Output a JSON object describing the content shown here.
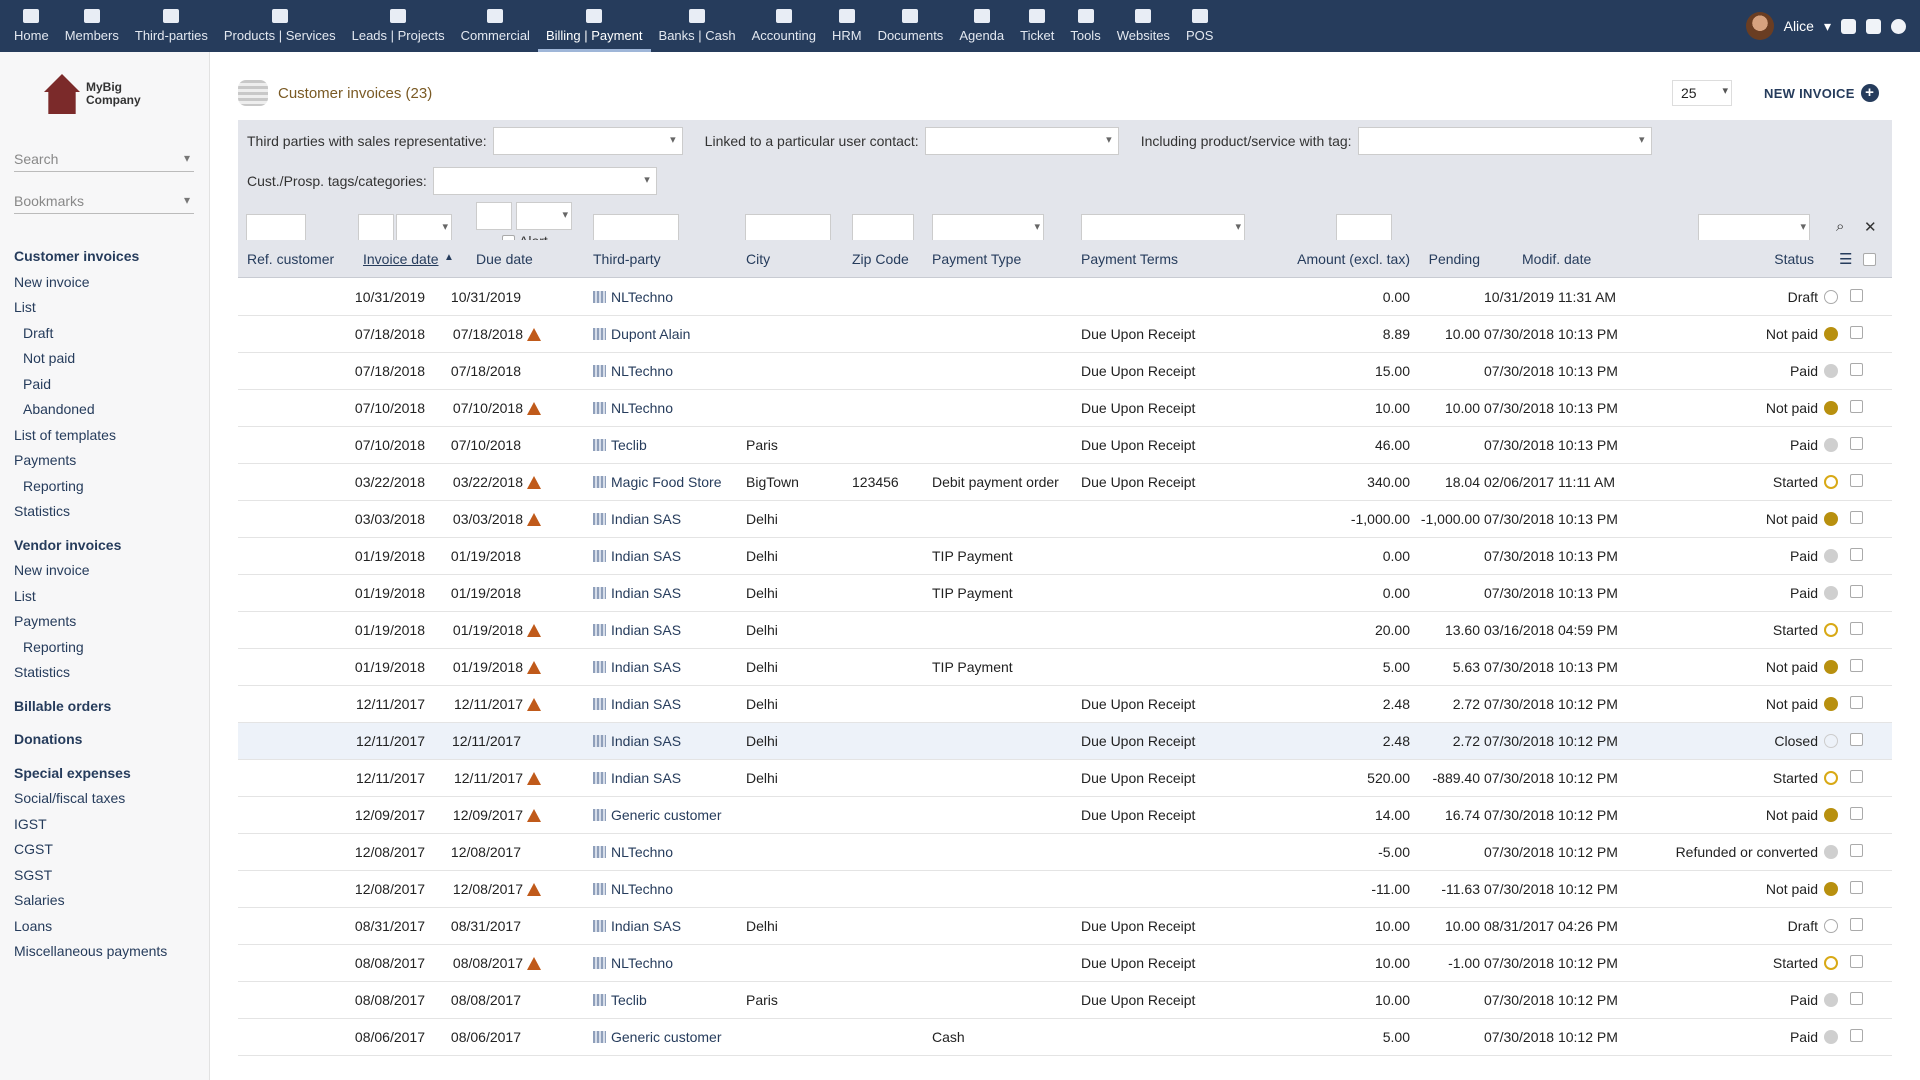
{
  "topmenu": [
    {
      "label": "Home",
      "icon": "home-icon"
    },
    {
      "label": "Members",
      "icon": "members-icon"
    },
    {
      "label": "Third-parties",
      "icon": "building-icon"
    },
    {
      "label": "Products | Services",
      "icon": "cube-icon"
    },
    {
      "label": "Leads | Projects",
      "icon": "sitemap-icon"
    },
    {
      "label": "Commercial",
      "icon": "suitcase-icon"
    },
    {
      "label": "Billing | Payment",
      "icon": "money-icon",
      "active": true
    },
    {
      "label": "Banks | Cash",
      "icon": "bank-icon"
    },
    {
      "label": "Accounting",
      "icon": "ledger-icon"
    },
    {
      "label": "HRM",
      "icon": "user-tie-icon"
    },
    {
      "label": "Documents",
      "icon": "folder-icon"
    },
    {
      "label": "Agenda",
      "icon": "calendar-icon"
    },
    {
      "label": "Ticket",
      "icon": "ticket-icon"
    },
    {
      "label": "Tools",
      "icon": "wrench-icon"
    },
    {
      "label": "Websites",
      "icon": "network-icon"
    },
    {
      "label": "POS",
      "icon": "cash-register-icon"
    }
  ],
  "user": {
    "name": "Alice"
  },
  "logo": {
    "line1": "MyBig",
    "line2": "Company"
  },
  "leftmenu": {
    "search_placeholder": "Search",
    "bookmarks_placeholder": "Bookmarks",
    "items": [
      {
        "label": "Customer invoices",
        "level": "head"
      },
      {
        "label": "New invoice",
        "level": "sub0"
      },
      {
        "label": "List",
        "level": "sub0"
      },
      {
        "label": "Draft",
        "level": "sub1"
      },
      {
        "label": "Not paid",
        "level": "sub1"
      },
      {
        "label": "Paid",
        "level": "sub1"
      },
      {
        "label": "Abandoned",
        "level": "sub1"
      },
      {
        "label": "List of templates",
        "level": "sub0"
      },
      {
        "label": "Payments",
        "level": "sub0"
      },
      {
        "label": "Reporting",
        "level": "sub1"
      },
      {
        "label": "Statistics",
        "level": "sub0"
      },
      {
        "label": "Vendor invoices",
        "level": "head"
      },
      {
        "label": "New invoice",
        "level": "sub0"
      },
      {
        "label": "List",
        "level": "sub0"
      },
      {
        "label": "Payments",
        "level": "sub0"
      },
      {
        "label": "Reporting",
        "level": "sub1"
      },
      {
        "label": "Statistics",
        "level": "sub0"
      },
      {
        "label": "Billable orders",
        "level": "head"
      },
      {
        "label": "Donations",
        "level": "head"
      },
      {
        "label": "Special expenses",
        "level": "head"
      },
      {
        "label": "Social/fiscal taxes",
        "level": "sub0"
      },
      {
        "label": "IGST",
        "level": "sub0"
      },
      {
        "label": "CGST",
        "level": "sub0"
      },
      {
        "label": "SGST",
        "level": "sub0"
      },
      {
        "label": "Salaries",
        "level": "sub0"
      },
      {
        "label": "Loans",
        "level": "sub0"
      },
      {
        "label": "Miscellaneous payments",
        "level": "sub0"
      }
    ]
  },
  "page": {
    "title": "Customer invoices (23)",
    "limit": "25",
    "new_button": "NEW INVOICE"
  },
  "filters": {
    "sales_rep_label": "Third parties with sales representative:",
    "user_contact_label": "Linked to a particular user contact:",
    "product_tag_label": "Including product/service with tag:",
    "cust_tags_label": "Cust./Prosp. tags/categories:",
    "alert_label": "Alert"
  },
  "columns": {
    "ref_customer": "Ref. customer",
    "invoice_date": "Invoice date",
    "due_date": "Due date",
    "third_party": "Third-party",
    "city": "City",
    "zip": "Zip Code",
    "payment_type": "Payment Type",
    "payment_terms": "Payment Terms",
    "amount": "Amount (excl. tax)",
    "pending": "Pending",
    "modif_date": "Modif. date",
    "status": "Status"
  },
  "status_colors": {
    "Draft": "outline-grey",
    "Not paid": "#b8900f",
    "Paid": "#cfcfcf",
    "Started": "outline-gold",
    "Closed": "outline-light",
    "Refunded or converted": "#cfcfcf"
  },
  "rows": [
    {
      "invoice_date": "10/31/2019",
      "due_date": "10/31/2019",
      "late": false,
      "third_party": "NLTechno",
      "city": "",
      "zip": "",
      "payment_type": "",
      "payment_terms": "",
      "amount": "0.00",
      "pending": "",
      "modif_date": "10/31/2019 11:31 AM",
      "status": "Draft"
    },
    {
      "invoice_date": "07/18/2018",
      "due_date": "07/18/2018",
      "late": true,
      "third_party": "Dupont Alain",
      "city": "",
      "zip": "",
      "payment_type": "",
      "payment_terms": "Due Upon Receipt",
      "amount": "8.89",
      "pending": "10.00",
      "modif_date": "07/30/2018 10:13 PM",
      "status": "Not paid"
    },
    {
      "invoice_date": "07/18/2018",
      "due_date": "07/18/2018",
      "late": false,
      "third_party": "NLTechno",
      "city": "",
      "zip": "",
      "payment_type": "",
      "payment_terms": "Due Upon Receipt",
      "amount": "15.00",
      "pending": "",
      "modif_date": "07/30/2018 10:13 PM",
      "status": "Paid"
    },
    {
      "invoice_date": "07/10/2018",
      "due_date": "07/10/2018",
      "late": true,
      "third_party": "NLTechno",
      "city": "",
      "zip": "",
      "payment_type": "",
      "payment_terms": "Due Upon Receipt",
      "amount": "10.00",
      "pending": "10.00",
      "modif_date": "07/30/2018 10:13 PM",
      "status": "Not paid"
    },
    {
      "invoice_date": "07/10/2018",
      "due_date": "07/10/2018",
      "late": false,
      "third_party": "Teclib",
      "city": "Paris",
      "zip": "",
      "payment_type": "",
      "payment_terms": "Due Upon Receipt",
      "amount": "46.00",
      "pending": "",
      "modif_date": "07/30/2018 10:13 PM",
      "status": "Paid"
    },
    {
      "invoice_date": "03/22/2018",
      "due_date": "03/22/2018",
      "late": true,
      "third_party": "Magic Food Store",
      "city": "BigTown",
      "zip": "123456",
      "payment_type": "Debit payment order",
      "payment_terms": "Due Upon Receipt",
      "amount": "340.00",
      "pending": "18.04",
      "modif_date": "02/06/2017 11:11 AM",
      "status": "Started"
    },
    {
      "invoice_date": "03/03/2018",
      "due_date": "03/03/2018",
      "late": true,
      "third_party": "Indian SAS",
      "city": "Delhi",
      "zip": "",
      "payment_type": "",
      "payment_terms": "",
      "amount": "-1,000.00",
      "pending": "-1,000.00",
      "modif_date": "07/30/2018 10:13 PM",
      "status": "Not paid"
    },
    {
      "invoice_date": "01/19/2018",
      "due_date": "01/19/2018",
      "late": false,
      "third_party": "Indian SAS",
      "city": "Delhi",
      "zip": "",
      "payment_type": "TIP Payment",
      "payment_terms": "",
      "amount": "0.00",
      "pending": "",
      "modif_date": "07/30/2018 10:13 PM",
      "status": "Paid"
    },
    {
      "invoice_date": "01/19/2018",
      "due_date": "01/19/2018",
      "late": false,
      "third_party": "Indian SAS",
      "city": "Delhi",
      "zip": "",
      "payment_type": "TIP Payment",
      "payment_terms": "",
      "amount": "0.00",
      "pending": "",
      "modif_date": "07/30/2018 10:13 PM",
      "status": "Paid"
    },
    {
      "invoice_date": "01/19/2018",
      "due_date": "01/19/2018",
      "late": true,
      "third_party": "Indian SAS",
      "city": "Delhi",
      "zip": "",
      "payment_type": "",
      "payment_terms": "",
      "amount": "20.00",
      "pending": "13.60",
      "modif_date": "03/16/2018 04:59 PM",
      "status": "Started"
    },
    {
      "invoice_date": "01/19/2018",
      "due_date": "01/19/2018",
      "late": true,
      "third_party": "Indian SAS",
      "city": "Delhi",
      "zip": "",
      "payment_type": "TIP Payment",
      "payment_terms": "",
      "amount": "5.00",
      "pending": "5.63",
      "modif_date": "07/30/2018 10:13 PM",
      "status": "Not paid"
    },
    {
      "invoice_date": "12/11/2017",
      "due_date": "12/11/2017",
      "late": true,
      "third_party": "Indian SAS",
      "city": "Delhi",
      "zip": "",
      "payment_type": "",
      "payment_terms": "Due Upon Receipt",
      "amount": "2.48",
      "pending": "2.72",
      "modif_date": "07/30/2018 10:12 PM",
      "status": "Not paid"
    },
    {
      "invoice_date": "12/11/2017",
      "due_date": "12/11/2017",
      "late": false,
      "third_party": "Indian SAS",
      "city": "Delhi",
      "zip": "",
      "payment_type": "",
      "payment_terms": "Due Upon Receipt",
      "amount": "2.48",
      "pending": "2.72",
      "modif_date": "07/30/2018 10:12 PM",
      "status": "Closed",
      "highlight": true
    },
    {
      "invoice_date": "12/11/2017",
      "due_date": "12/11/2017",
      "late": true,
      "third_party": "Indian SAS",
      "city": "Delhi",
      "zip": "",
      "payment_type": "",
      "payment_terms": "Due Upon Receipt",
      "amount": "520.00",
      "pending": "-889.40",
      "modif_date": "07/30/2018 10:12 PM",
      "status": "Started"
    },
    {
      "invoice_date": "12/09/2017",
      "due_date": "12/09/2017",
      "late": true,
      "third_party": "Generic customer",
      "city": "",
      "zip": "",
      "payment_type": "",
      "payment_terms": "Due Upon Receipt",
      "amount": "14.00",
      "pending": "16.74",
      "modif_date": "07/30/2018 10:12 PM",
      "status": "Not paid"
    },
    {
      "invoice_date": "12/08/2017",
      "due_date": "12/08/2017",
      "late": false,
      "third_party": "NLTechno",
      "city": "",
      "zip": "",
      "payment_type": "",
      "payment_terms": "",
      "amount": "-5.00",
      "pending": "",
      "modif_date": "07/30/2018 10:12 PM",
      "status": "Refunded or converted"
    },
    {
      "invoice_date": "12/08/2017",
      "due_date": "12/08/2017",
      "late": true,
      "third_party": "NLTechno",
      "city": "",
      "zip": "",
      "payment_type": "",
      "payment_terms": "",
      "amount": "-11.00",
      "pending": "-11.63",
      "modif_date": "07/30/2018 10:12 PM",
      "status": "Not paid"
    },
    {
      "invoice_date": "08/31/2017",
      "due_date": "08/31/2017",
      "late": false,
      "third_party": "Indian SAS",
      "city": "Delhi",
      "zip": "",
      "payment_type": "",
      "payment_terms": "Due Upon Receipt",
      "amount": "10.00",
      "pending": "10.00",
      "modif_date": "08/31/2017 04:26 PM",
      "status": "Draft"
    },
    {
      "invoice_date": "08/08/2017",
      "due_date": "08/08/2017",
      "late": true,
      "third_party": "NLTechno",
      "city": "",
      "zip": "",
      "payment_type": "",
      "payment_terms": "Due Upon Receipt",
      "amount": "10.00",
      "pending": "-1.00",
      "modif_date": "07/30/2018 10:12 PM",
      "status": "Started"
    },
    {
      "invoice_date": "08/08/2017",
      "due_date": "08/08/2017",
      "late": false,
      "third_party": "Teclib",
      "city": "Paris",
      "zip": "",
      "payment_type": "",
      "payment_terms": "Due Upon Receipt",
      "amount": "10.00",
      "pending": "",
      "modif_date": "07/30/2018 10:12 PM",
      "status": "Paid"
    },
    {
      "invoice_date": "08/06/2017",
      "due_date": "08/06/2017",
      "late": false,
      "third_party": "Generic customer",
      "city": "",
      "zip": "",
      "payment_type": "Cash",
      "payment_terms": "",
      "amount": "5.00",
      "pending": "",
      "modif_date": "07/30/2018 10:12 PM",
      "status": "Paid"
    }
  ]
}
